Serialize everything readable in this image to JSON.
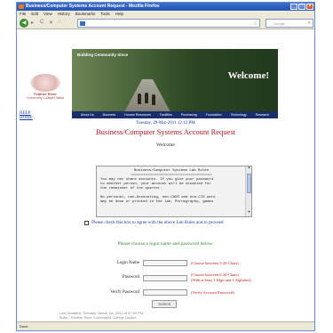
{
  "window": {
    "title": "Business/Computer Systems Account Request - Mozilla Firefox",
    "controls": [
      "_",
      "□",
      "×"
    ]
  },
  "menu": [
    "File",
    "Edit",
    "View",
    "History",
    "Bookmarks",
    "Tools",
    "Help"
  ],
  "nav": {
    "back_glyph": "◀",
    "forward_glyph": "▸",
    "reload_glyph": "C",
    "stop_glyph": "✕",
    "home_glyph": "⌂",
    "bookmark_star": "☆",
    "search_placeholder": "Google",
    "search_glyph": "⌕"
  },
  "banner": {
    "tagline": "Building Community Since",
    "welcome": "Welcome!",
    "nav_items": [
      "About Us",
      "Business",
      "Human Resources",
      "Facilities",
      "Purchasing",
      "Foundation",
      "Technology",
      "Research"
    ]
  },
  "logo": {
    "title": "Feather River",
    "subtitle": "Community College District"
  },
  "side_links": [
    "HELP",
    "HOME"
  ],
  "date": "Tuesday, 29-Mar-2011 12:12 PM",
  "page_title": "Business/Computer Systems Account Request",
  "welcome_text": "Welcome",
  "rules": {
    "title": "Business/Computer Systems Lab Rules",
    "separator": "======================================",
    "lines": [
      "You may not share accounts.  If you give your password",
      "to another person, your account will be disabled for",
      "the remainder of the quarter.",
      "",
      "No personal, non-Accounting, non-CAOS and non-CIS work",
      "may be done or printed in the lab.  Pornography, games"
    ]
  },
  "agree_text": "Please check this box to agree with the above Lab Rules and to proceed",
  "choose_text": "Please choose a login name and password below:",
  "form": {
    "login_label": "Login Name",
    "login_hint": "(Choose between 5-20 Chars)",
    "password_label": "Password",
    "password_hint_1": "(Choose between 6-20 Chars)",
    "password_hint_2": "(With at least 1 Digit and 1 Alphabet)",
    "verify_label": "Verify Password",
    "verify_hint": "(Verify Account Password)",
    "submit_label": "Submit"
  },
  "footer": {
    "line1": "Last Updated: Tuesday, March 1st, 2011 at 07:59 PM",
    "line2": "Butte / Feather River Community College District"
  },
  "status": {
    "left": "Done",
    "right": ""
  },
  "colors": {
    "title_red": "#a8141c",
    "link_blue": "#1a3caa",
    "green_heading": "#2e8b2e"
  }
}
